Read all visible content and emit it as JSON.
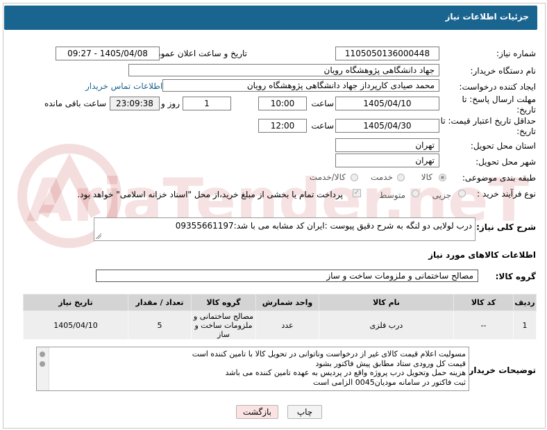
{
  "header": {
    "title": "جزئیات اطلاعات نیاز"
  },
  "watermark": {
    "text": "AriaTender.neT"
  },
  "fields": {
    "need_number_label": "شماره نیاز:",
    "need_number": "1105050136000448",
    "announce_label": "تاریخ و ساعت اعلان عمومی:",
    "announce_value": "1405/04/08 - 09:27",
    "buyer_label": "نام دستگاه خریدار:",
    "buyer": "جهاد دانشگاهی پژوهشگاه رویان",
    "creator_label": "ایجاد کننده درخواست:",
    "creator": "محمد صیادی کارپرداز جهاد دانشگاهی پژوهشگاه رویان",
    "contact_link": "اطلاعات تماس خریدار",
    "deadline_label": "مهلت ارسال پاسخ: تا تاریخ:",
    "deadline_date": "1405/04/10",
    "time_word": "ساعت",
    "deadline_time": "10:00",
    "days": "1",
    "day_word": "روز و",
    "remaining_time": "23:09:38",
    "remaining_word": "ساعت باقی مانده",
    "validity_label": "حداقل تاریخ اعتبار قیمت: تا تاریخ:",
    "validity_date": "1405/04/30",
    "validity_time": "12:00",
    "province_label": "استان محل تحویل:",
    "province": "تهران",
    "city_label": "شهر محل تحویل:",
    "city": "تهران",
    "category_label": "طبقه بندی موضوعی:",
    "category_options": [
      "کالا",
      "خدمت",
      "کالا/خدمت"
    ],
    "process_label": "نوع فرآیند خرید :",
    "process_options": [
      "جزیی",
      "متوسط"
    ],
    "payment_note": "پرداخت تمام یا بخشی از مبلغ خرید،از محل \"اسناد خزانه اسلامی\" خواهد بود."
  },
  "description": {
    "label": "شرح کلی نیاز:",
    "text": "درب لولایی دو لنگه به شرح دقیق پیوست :ایران کد مشابه می با شد:09355661197"
  },
  "goods": {
    "section_title": "اطلاعات کالاهای مورد نیاز",
    "group_label": "گروه کالا:",
    "group_value": "مصالح ساختمانی و ملزومات ساخت و ساز",
    "columns": [
      "ردیف",
      "کد کالا",
      "نام کالا",
      "واحد شمارش",
      "گروه کالا",
      "تعداد / مقدار",
      "تاریخ نیاز"
    ],
    "rows": [
      {
        "row": "1",
        "code": "--",
        "name": "درب فلزی",
        "unit": "عدد",
        "group": "مصالح ساختمانی و ملزومات ساخت و ساز",
        "qty": "5",
        "date": "1405/04/10"
      }
    ]
  },
  "buyer_notes": {
    "label": "توضیحات خریدار:",
    "lines": [
      "مسولیت اعلام  قیمت کالای غیر از درخواست وناتوانی در تحویل کالا با تامین کننده است",
      "قیمت کل ورودی ستاد مطابق پیش فاکتور بشود",
      "هزینه حمل وتحویل درب پروژه واقع در پردیس به عهده تامین کننده می باشد",
      "ثبت فاکتور در سامانه مودیان0045 الزامی است"
    ]
  },
  "buttons": {
    "print": "چاپ",
    "back": "بازگشت"
  },
  "colors": {
    "header_bg": "#1a6590",
    "link": "#1a6590",
    "back_button_bg": "#fbe3e3"
  }
}
